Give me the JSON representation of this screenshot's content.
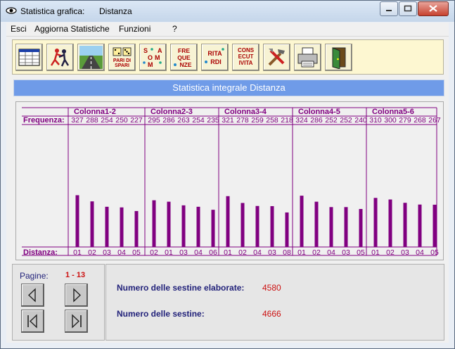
{
  "window": {
    "title": "Statistica grafica:",
    "subtitle": "Distanza"
  },
  "menu": [
    "Esci",
    "Aggiorna Statistiche",
    "Funzioni",
    "?"
  ],
  "toolbar": {
    "buttons": [
      {
        "name": "table-icon"
      },
      {
        "name": "dancers-icon"
      },
      {
        "name": "road-icon"
      },
      {
        "name": "pari-dispari-icon",
        "text": "PARI DI SPARI"
      },
      {
        "name": "somma-icon",
        "text": "S O M M A"
      },
      {
        "name": "frequenze-icon",
        "text": "FRE QUE NZE"
      },
      {
        "name": "ritardi-icon",
        "text": "RITA RDI"
      },
      {
        "name": "consecutivita-icon",
        "text": "CONS ECUT IVITA"
      },
      {
        "name": "tools-icon"
      },
      {
        "name": "printer-icon"
      },
      {
        "name": "exit-door-icon"
      }
    ]
  },
  "banner": "Statistica integrale Distanza",
  "chart_data": {
    "type": "bar",
    "row_labels": {
      "freq": "Frequenza:",
      "dist": "Distanza:"
    },
    "color": "#800080",
    "groups": [
      {
        "name": "Colonna1-2",
        "freq": [
          327,
          288,
          254,
          250,
          227
        ],
        "dist": [
          "01",
          "02",
          "03",
          "04",
          "05"
        ]
      },
      {
        "name": "Colonna2-3",
        "freq": [
          295,
          286,
          263,
          254,
          235
        ],
        "dist": [
          "02",
          "01",
          "03",
          "04",
          "06"
        ]
      },
      {
        "name": "Colonna3-4",
        "freq": [
          321,
          278,
          259,
          258,
          218
        ],
        "dist": [
          "01",
          "02",
          "04",
          "03",
          "08"
        ]
      },
      {
        "name": "Colonna4-5",
        "freq": [
          324,
          286,
          252,
          252,
          240
        ],
        "dist": [
          "01",
          "02",
          "04",
          "03",
          "05"
        ]
      },
      {
        "name": "Colonna5-6",
        "freq": [
          310,
          300,
          279,
          268,
          267
        ],
        "dist": [
          "01",
          "02",
          "03",
          "04",
          "05"
        ]
      }
    ]
  },
  "pages": {
    "label": "Pagine:",
    "value": "1 - 13"
  },
  "nav": {
    "prev": "prev-page-icon",
    "next": "next-page-icon",
    "first": "first-page-icon",
    "last": "last-page-icon"
  },
  "info": {
    "elaborated_label": "Numero delle sestine elaborate:",
    "elaborated_value": "4580",
    "total_label": "Numero delle sestine:",
    "total_value": "4666"
  }
}
